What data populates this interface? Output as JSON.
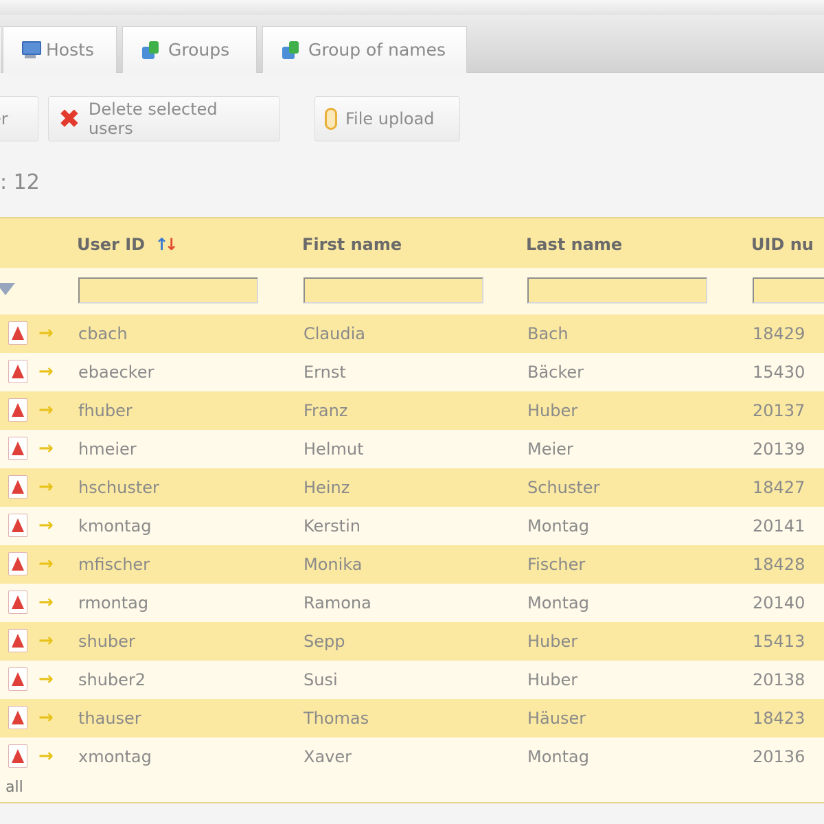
{
  "tabs": [
    {
      "label": "Hosts",
      "icon": "hosts-icon"
    },
    {
      "label": "Groups",
      "icon": "group-icon"
    },
    {
      "label": "Group of names",
      "icon": "group-icon"
    }
  ],
  "toolbar": {
    "partial_button_label": "er",
    "delete_label": "Delete selected users",
    "upload_label": "File upload",
    "count_text": ": 12"
  },
  "table": {
    "columns": [
      "User ID",
      "First name",
      "Last name",
      "UID nu"
    ],
    "sorted_column": "User ID",
    "rows": [
      {
        "uid": "cbach",
        "first": "Claudia",
        "last": "Bach",
        "num": "18429"
      },
      {
        "uid": "ebaecker",
        "first": "Ernst",
        "last": "Bäcker",
        "num": "15430"
      },
      {
        "uid": "fhuber",
        "first": "Franz",
        "last": "Huber",
        "num": "20137"
      },
      {
        "uid": "hmeier",
        "first": "Helmut",
        "last": "Meier",
        "num": "20139"
      },
      {
        "uid": "hschuster",
        "first": "Heinz",
        "last": "Schuster",
        "num": "18427"
      },
      {
        "uid": "kmontag",
        "first": "Kerstin",
        "last": "Montag",
        "num": "20141"
      },
      {
        "uid": "mfischer",
        "first": "Monika",
        "last": "Fischer",
        "num": "18428"
      },
      {
        "uid": "rmontag",
        "first": "Ramona",
        "last": "Montag",
        "num": "20140"
      },
      {
        "uid": "shuber",
        "first": "Sepp",
        "last": "Huber",
        "num": "15413"
      },
      {
        "uid": "shuber2",
        "first": "Susi",
        "last": "Huber",
        "num": "20138"
      },
      {
        "uid": "thauser",
        "first": "Thomas",
        "last": "Häuser",
        "num": "18423"
      },
      {
        "uid": "xmontag",
        "first": "Xaver",
        "last": "Montag",
        "num": "20136"
      }
    ],
    "footer_label": "all"
  },
  "colors": {
    "row_odd": "#fbe9a2",
    "row_even": "#fffaea",
    "delete_icon": "#e23a2c"
  }
}
